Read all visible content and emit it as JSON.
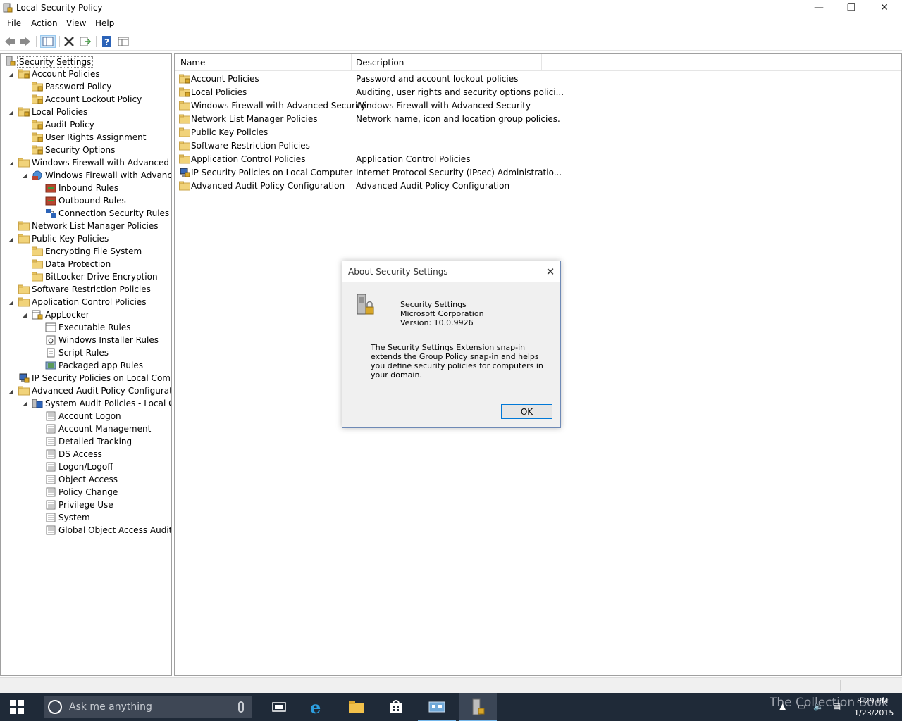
{
  "window": {
    "title": "Local Security Policy",
    "min_glyph": "—",
    "max_glyph": "❐",
    "close_glyph": "✕"
  },
  "menu": [
    "File",
    "Action",
    "View",
    "Help"
  ],
  "toolbar": {
    "buttons": [
      "back-arrow-icon",
      "forward-arrow-icon",
      "show-hide-tree-icon",
      "delete-icon",
      "export-list-icon",
      "help-icon",
      "properties-icon"
    ]
  },
  "tree": {
    "root": "Security Settings",
    "items": [
      {
        "label": "Account Policies"
      },
      {
        "label": "Password Policy"
      },
      {
        "label": "Account Lockout Policy"
      },
      {
        "label": "Local Policies"
      },
      {
        "label": "Audit Policy"
      },
      {
        "label": "User Rights Assignment"
      },
      {
        "label": "Security Options"
      },
      {
        "label": "Windows Firewall with Advanced Secu"
      },
      {
        "label": "Windows Firewall with Advanced"
      },
      {
        "label": "Inbound Rules"
      },
      {
        "label": "Outbound Rules"
      },
      {
        "label": "Connection Security Rules"
      },
      {
        "label": "Network List Manager Policies"
      },
      {
        "label": "Public Key Policies"
      },
      {
        "label": "Encrypting File System"
      },
      {
        "label": "Data Protection"
      },
      {
        "label": "BitLocker Drive Encryption"
      },
      {
        "label": "Software Restriction Policies"
      },
      {
        "label": "Application Control Policies"
      },
      {
        "label": "AppLocker"
      },
      {
        "label": "Executable Rules"
      },
      {
        "label": "Windows Installer Rules"
      },
      {
        "label": "Script Rules"
      },
      {
        "label": "Packaged app Rules"
      },
      {
        "label": "IP Security Policies on Local Compute"
      },
      {
        "label": "Advanced Audit Policy Configuration"
      },
      {
        "label": "System Audit Policies - Local Grou"
      },
      {
        "label": "Account Logon"
      },
      {
        "label": "Account Management"
      },
      {
        "label": "Detailed Tracking"
      },
      {
        "label": "DS Access"
      },
      {
        "label": "Logon/Logoff"
      },
      {
        "label": "Object Access"
      },
      {
        "label": "Policy Change"
      },
      {
        "label": "Privilege Use"
      },
      {
        "label": "System"
      },
      {
        "label": "Global Object Access Auditing"
      }
    ]
  },
  "list": {
    "columns": [
      "Name",
      "Description"
    ],
    "rows": [
      {
        "name": "Account Policies",
        "description": "Password and account lockout policies"
      },
      {
        "name": "Local Policies",
        "description": "Auditing, user rights and security options polici..."
      },
      {
        "name": "Windows Firewall with Advanced Security",
        "description": "Windows Firewall with Advanced Security"
      },
      {
        "name": "Network List Manager Policies",
        "description": "Network name, icon and location group policies."
      },
      {
        "name": "Public Key Policies",
        "description": ""
      },
      {
        "name": "Software Restriction Policies",
        "description": ""
      },
      {
        "name": "Application Control Policies",
        "description": "Application Control Policies"
      },
      {
        "name": "IP Security Policies on Local Computer",
        "description": "Internet Protocol Security (IPsec) Administratio..."
      },
      {
        "name": "Advanced Audit Policy Configuration",
        "description": "Advanced Audit Policy Configuration"
      }
    ]
  },
  "dialog": {
    "title": "About Security Settings",
    "close_glyph": "✕",
    "product": "Security Settings",
    "company": "Microsoft Corporation",
    "version": "Version: 10.0.9926",
    "description": "The Security Settings Extension snap-in extends the Group Policy snap-in and helps you define security policies for computers in your domain.",
    "ok_label": "OK"
  },
  "taskbar": {
    "search_placeholder": "Ask me anything",
    "watermark": "The Collection Book",
    "time": "8:29 PM",
    "date": "1/23/2015",
    "apps": [
      "task-view-icon",
      "internet-explorer-icon",
      "file-explorer-icon",
      "store-icon",
      "network-app-icon",
      "local-security-policy-icon"
    ]
  },
  "colors": {
    "taskbar": "#1f2a38",
    "dialog_border": "#6e89b5",
    "ok_border": "#0078d7",
    "folder": "#f1d37a"
  }
}
